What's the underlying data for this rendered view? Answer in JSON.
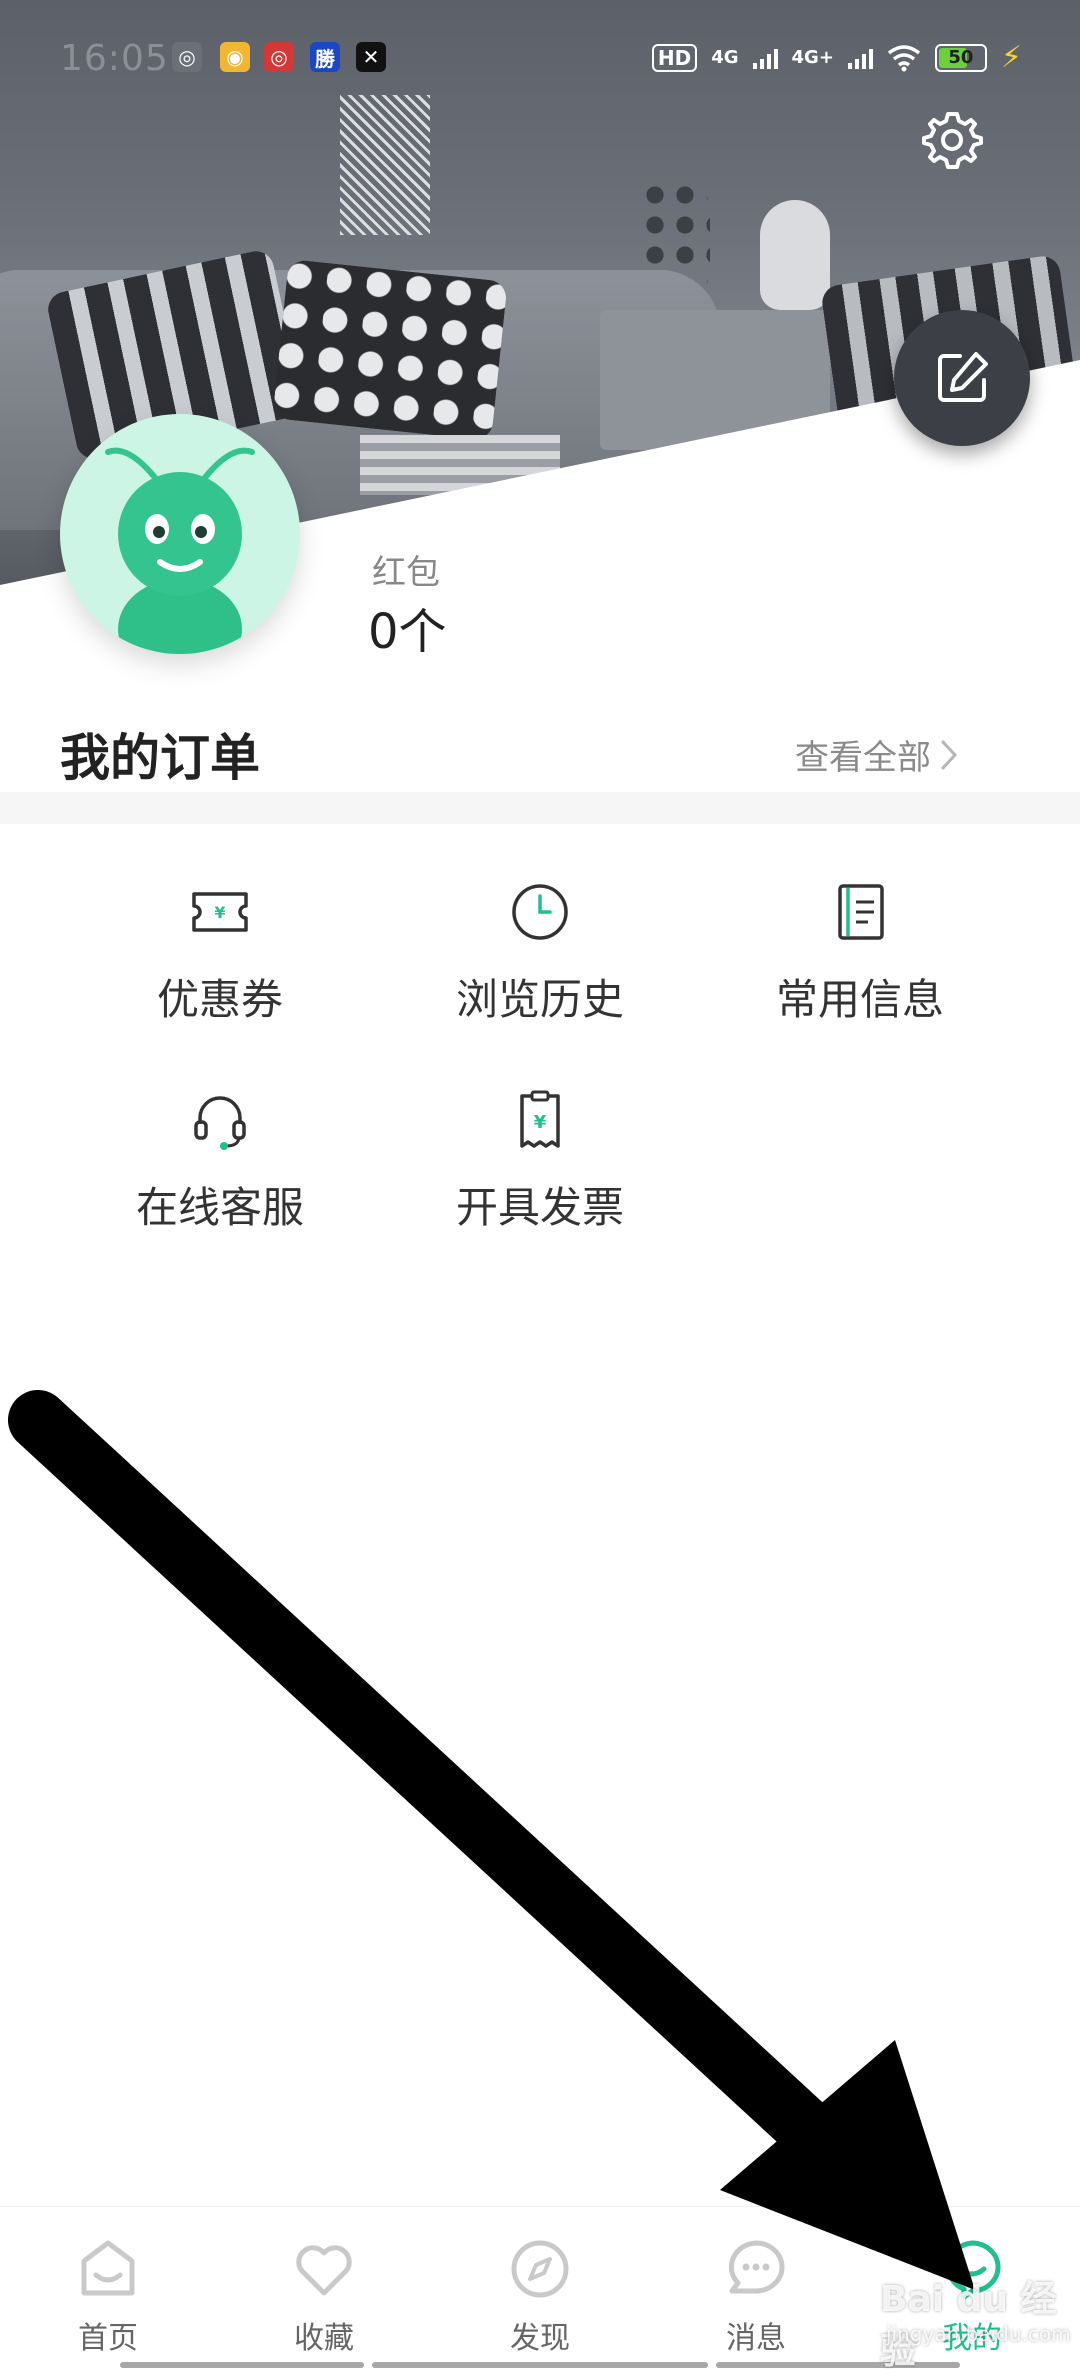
{
  "status_bar": {
    "time": "16:05",
    "hd_badge": "HD",
    "net_1": "4G",
    "net_2": "4G+",
    "battery": "50"
  },
  "header": {
    "settings_icon": "gear-icon",
    "edit_icon": "edit-icon"
  },
  "profile": {
    "red_packet_label": "红包",
    "red_packet_value": "0个"
  },
  "orders": {
    "title": "我的订单",
    "view_all": "查看全部"
  },
  "services": [
    {
      "label": "优惠券",
      "icon": "coupon-icon"
    },
    {
      "label": "浏览历史",
      "icon": "clock-icon"
    },
    {
      "label": "常用信息",
      "icon": "notebook-icon"
    },
    {
      "label": "在线客服",
      "icon": "headset-icon"
    },
    {
      "label": "开具发票",
      "icon": "invoice-icon"
    }
  ],
  "bottom_nav": [
    {
      "label": "首页",
      "icon": "home-icon"
    },
    {
      "label": "收藏",
      "icon": "heart-icon"
    },
    {
      "label": "发现",
      "icon": "compass-icon"
    },
    {
      "label": "消息",
      "icon": "message-icon"
    },
    {
      "label": "我的",
      "icon": "profile-icon",
      "active": true
    }
  ],
  "watermark": {
    "text": "Bai du 经验",
    "sub": "jingyan.baidu.com"
  },
  "colors": {
    "accent": "#1fbf8f",
    "edit_button": "#3c4046"
  }
}
